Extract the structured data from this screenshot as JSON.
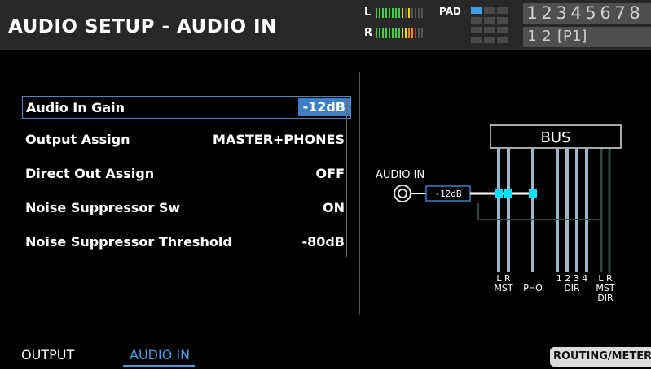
{
  "header": {
    "title": "AUDIO SETUP - AUDIO IN",
    "meter_left_label": "L",
    "meter_right_label": "R",
    "pad_label": "PAD",
    "bank_numbers": [
      "1",
      "2",
      "3",
      "4",
      "5",
      "6",
      "7",
      "8"
    ],
    "sub_numbers": [
      "1",
      "2"
    ],
    "sub_page": "[P1]"
  },
  "params": [
    {
      "label": "Audio In Gain",
      "value": "-12dB",
      "selected": true
    },
    {
      "label": "Output Assign",
      "value": "MASTER+PHONES"
    },
    {
      "label": "Direct Out Assign",
      "value": "OFF"
    },
    {
      "label": "Noise Suppressor Sw",
      "value": "ON"
    },
    {
      "label": "Noise Suppressor Threshold",
      "value": "-80dB"
    }
  ],
  "diagram": {
    "bus_label": "BUS",
    "input_label": "AUDIO IN",
    "gain_value": "-12dB",
    "mst_lr": "L R",
    "mst": "MST",
    "pho": "PHO",
    "dir_nums": "1 2 3 4",
    "dir": "DIR",
    "mst_dir_lr": "L R",
    "mst_dir_1": "MST",
    "mst_dir_2": "DIR"
  },
  "colors": {
    "accent_blue": "#3f7fc6",
    "node_cyan": "#00e5ff",
    "bus_line": "#9fb6c8"
  },
  "tabs": {
    "output": "OUTPUT",
    "audio_in": "AUDIO IN"
  },
  "routing_button": "ROUTING/METER"
}
